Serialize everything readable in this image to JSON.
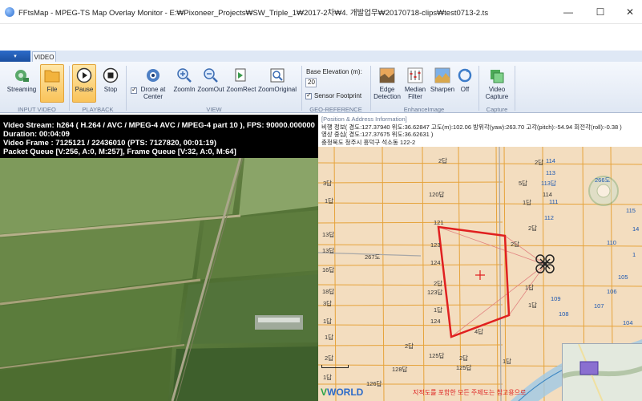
{
  "window": {
    "title": "FFtsMap - MPEG-TS Map Overlay Monitor - E:₩Pixoneer_Projects₩SW_Triple_1₩2017-2차₩4. 개발업무₩20170718-clips₩test0713-2.ts",
    "controls": {
      "minimize": "—",
      "maximize": "☐",
      "close": "✕"
    }
  },
  "ribbon": {
    "app_menu": "▾",
    "tab": "VIDEO",
    "input_video": {
      "label": "INPUT VIDEO",
      "streaming": "Streaming",
      "file": "File"
    },
    "playback": {
      "label": "PLAYBACK",
      "pause": "Pause",
      "stop": "Stop"
    },
    "view": {
      "label": "VIEW",
      "drone_center_line1": "Drone at",
      "drone_center_line2": "Center",
      "zoomin": "ZoomIn",
      "zoomout": "ZoomOut",
      "zoomrect": "ZoomRect",
      "zoomoriginal": "ZoomOriginal"
    },
    "geo_reference": {
      "label": "GEO-REFERENCE",
      "base_elevation_label": "Base Elevation (m):",
      "base_elevation_value": "20",
      "sensor_footprint": "Sensor Footprint"
    },
    "enhance": {
      "label": "EnhanceImage",
      "edge_line1": "Edge",
      "edge_line2": "Detection",
      "median_line1": "Median",
      "median_line2": "Filter",
      "sharpen": "Sharpen",
      "off": "Off"
    },
    "capture": {
      "label": "Capture",
      "video_line1": "Video",
      "video_line2": "Capture"
    }
  },
  "video": {
    "info_lines": [
      "Video Stream: h264 ( H.264 / AVC / MPEG-4 AVC / MPEG-4 part 10 ), FPS: 90000.000000",
      "Duration: 00:04:09",
      "Video Frame : 7125121 / 22436010   (PTS: 7127820, 00:01:19)",
      "Packet Queue [V:256, A:0, M:257], Frame Queue [V:32, A:0, M:64]"
    ]
  },
  "map": {
    "info_legend": "[Position & Address Information]",
    "info_lines": [
      "비행 정보( 경도:127.37940 위도:36.62847 고도(m):102.06 방위각(yaw):263.70 고각(pitch):-54.94 회전각(roll):-0.38 )",
      "영상 중심( 경도:127.37675 위도:36.62631 )",
      "충청북도 청주시 흥덕구 석소동 122-2"
    ],
    "lots": [
      "2답",
      "2답",
      "3답",
      "120답",
      "1답",
      "5답",
      "13답",
      "13답",
      "16답",
      "18답",
      "267도",
      "123답",
      "124",
      "123",
      "1답",
      "2답",
      "124",
      "1답",
      "125답",
      "4답",
      "2답",
      "128답",
      "125답",
      "2답",
      "126답",
      "2답",
      "1답",
      "3답",
      "1답",
      "121",
      "1답",
      "2답",
      "1답",
      "114",
      "1답",
      "2답",
      "1답"
    ],
    "lots_blue": [
      "114",
      "113답",
      "266도",
      "113",
      "112",
      "110",
      "105",
      "108",
      "107",
      "106",
      "115",
      "109",
      "111",
      "14",
      "104",
      "1",
      "청주"
    ],
    "vworld": [
      "V",
      "WORLD"
    ],
    "disclaimer": "지적도를 포함한 모든 주제도는 참고용으로"
  }
}
